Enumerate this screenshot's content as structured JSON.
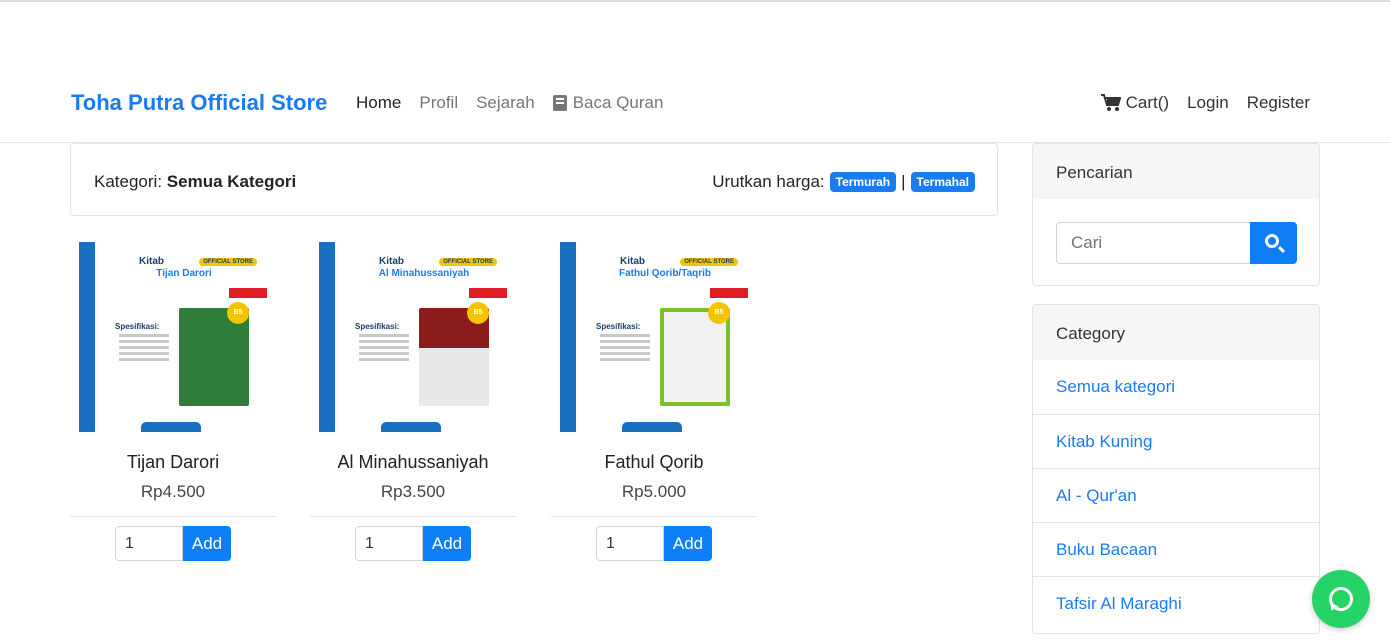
{
  "navbar": {
    "brand": "Toha Putra Official Store",
    "links": [
      "Home",
      "Profil",
      "Sejarah",
      "Baca Quran"
    ],
    "cart": "Cart()",
    "login": "Login",
    "register": "Register"
  },
  "filter": {
    "kategori_label": "Kategori:",
    "kategori_value": "Semua Kategori",
    "sort_label": "Urutkan harga:",
    "sort_cheapest": "Termurah",
    "separator": "|",
    "sort_expensive": "Termahal"
  },
  "products": [
    {
      "title": "Tijan Darori",
      "price": "Rp4.500",
      "qty": "1",
      "add": "Add",
      "cover_line1": "Kitab",
      "cover_line2": "Tijan Darori"
    },
    {
      "title": "Al Minahussaniyah",
      "price": "Rp3.500",
      "qty": "1",
      "add": "Add",
      "cover_line1": "Kitab",
      "cover_line2": "Al Minahussaniyah"
    },
    {
      "title": "Fathul Qorib",
      "price": "Rp5.000",
      "qty": "1",
      "add": "Add",
      "cover_line1": "Kitab",
      "cover_line2": "Fathul Qorib/Taqrib"
    }
  ],
  "cover_common": {
    "official": "OFFICIAL STORE",
    "spec": "Spesifikasi:",
    "b5": "B5"
  },
  "sidebar": {
    "search_title": "Pencarian",
    "search_placeholder": "Cari",
    "category_title": "Category",
    "categories": [
      "Semua kategori",
      "Kitab Kuning",
      "Al - Qur'an",
      "Buku Bacaan",
      "Tafsir Al Maraghi"
    ]
  },
  "colors": {
    "primary": "#0d7ef5",
    "brand": "#1a7cf0",
    "whatsapp": "#25d366"
  },
  "icons": {
    "cart": "cart-icon",
    "book": "book-icon",
    "search": "search-icon",
    "whatsapp": "whatsapp-icon"
  }
}
